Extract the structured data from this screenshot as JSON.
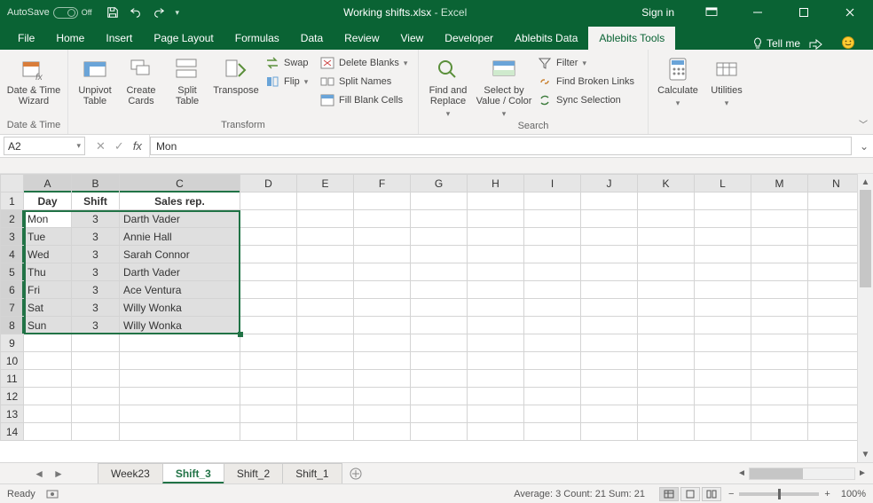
{
  "title": {
    "autosave_label": "AutoSave",
    "autosave_state": "Off",
    "doc": "Working shifts.xlsx",
    "app_suffix": " - Excel",
    "signin": "Sign in"
  },
  "tabs": {
    "file": "File",
    "home": "Home",
    "insert": "Insert",
    "page_layout": "Page Layout",
    "formulas": "Formulas",
    "data": "Data",
    "review": "Review",
    "view": "View",
    "developer": "Developer",
    "ablebits_data": "Ablebits Data",
    "ablebits_tools": "Ablebits Tools",
    "tellme": "Tell me"
  },
  "ribbon": {
    "group_datetime": "Date & Time",
    "group_transform": "Transform",
    "group_search": "Search",
    "date_time_wizard": "Date & Time Wizard",
    "unpivot": "Unpivot Table",
    "create_cards": "Create Cards",
    "split_table": "Split Table",
    "transpose": "Transpose",
    "swap": "Swap",
    "flip": "Flip",
    "delete_blanks": "Delete Blanks",
    "split_names": "Split Names",
    "fill_blank": "Fill Blank Cells",
    "find_replace": "Find and Replace",
    "select_by": "Select by Value / Color",
    "filter": "Filter",
    "find_broken": "Find Broken Links",
    "sync_sel": "Sync Selection",
    "calculate": "Calculate",
    "utilities": "Utilities"
  },
  "namebox": "A2",
  "formula": "Mon",
  "columns": [
    "A",
    "B",
    "C",
    "D",
    "E",
    "F",
    "G",
    "H",
    "I",
    "J",
    "K",
    "L",
    "M",
    "N"
  ],
  "row_numbers": [
    1,
    2,
    3,
    4,
    5,
    6,
    7,
    8,
    9,
    10,
    11,
    12,
    13,
    14
  ],
  "headers": {
    "A": "Day",
    "B": "Shift",
    "C": "Sales rep."
  },
  "rows": [
    {
      "A": "Mon",
      "B": 3,
      "C": "Darth Vader"
    },
    {
      "A": "Tue",
      "B": 3,
      "C": "Annie Hall"
    },
    {
      "A": "Wed",
      "B": 3,
      "C": "Sarah Connor"
    },
    {
      "A": "Thu",
      "B": 3,
      "C": "Darth Vader"
    },
    {
      "A": "Fri",
      "B": 3,
      "C": "Ace Ventura"
    },
    {
      "A": "Sat",
      "B": 3,
      "C": "Willy Wonka"
    },
    {
      "A": "Sun",
      "B": 3,
      "C": "Willy Wonka"
    }
  ],
  "sheets": {
    "list": [
      "Week23",
      "Shift_3",
      "Shift_2",
      "Shift_1"
    ],
    "active": "Shift_3"
  },
  "status": {
    "ready": "Ready",
    "stats": "Average: 3    Count: 21    Sum: 21",
    "zoom": "100%"
  }
}
